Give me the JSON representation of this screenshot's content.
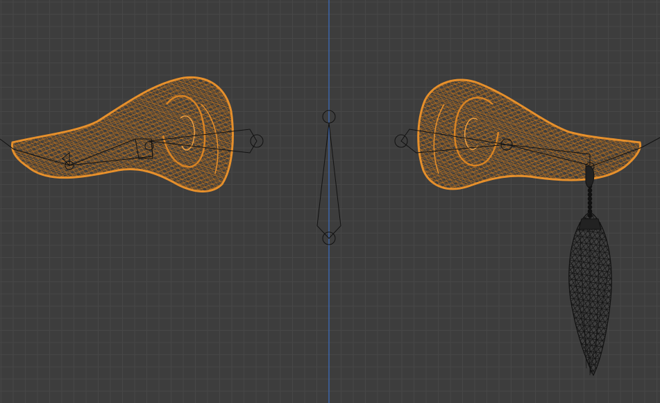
{
  "viewport": {
    "background": "#3d3d3d",
    "grid_minor_color": "#474747",
    "grid_major_color": "#4c4c4c",
    "axis_color": "#3d6fc4"
  },
  "objects": [
    {
      "name": "ear-left",
      "selected": true,
      "wire_color": "#e8912c"
    },
    {
      "name": "ear-right",
      "selected": true,
      "wire_color": "#e8912c"
    },
    {
      "name": "tassel-earring",
      "selected": false,
      "wire_color": "#111111"
    },
    {
      "name": "center-bone",
      "selected": false,
      "wire_color": "#111111"
    }
  ]
}
